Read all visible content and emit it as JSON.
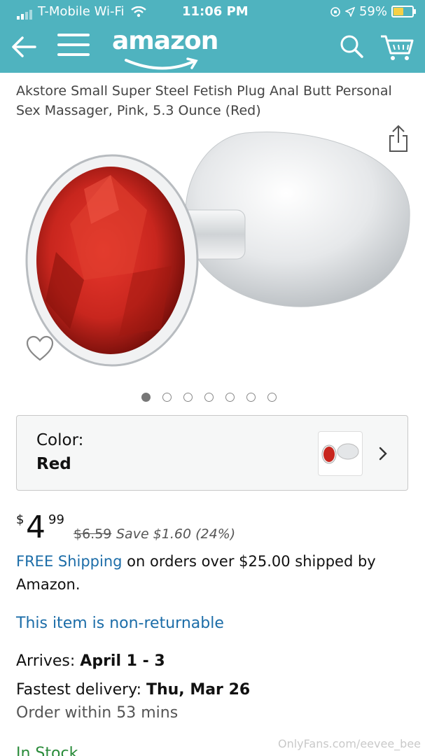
{
  "status": {
    "carrier": "T-Mobile Wi-Fi",
    "time": "11:06 PM",
    "battery": "59%"
  },
  "nav": {
    "logo": "amazon"
  },
  "product": {
    "title": "Akstore Small Super Steel Fetish Plug Anal Butt Personal Sex Massager, Pink, 5.3 Ounce (Red)",
    "image_count": 7,
    "active_image": 1
  },
  "color_selector": {
    "label": "Color:",
    "value": "Red"
  },
  "price": {
    "currency": "$",
    "whole": "4",
    "cents": "99",
    "was": "$6.59",
    "save": "Save $1.60 (24%)"
  },
  "shipping": {
    "link": "FREE Shipping",
    "text": " on orders over $25.00 shipped by Amazon."
  },
  "returns": {
    "text": "This item is non-returnable"
  },
  "delivery": {
    "arrives_label": "Arrives: ",
    "arrives_value": "April 1 - 3",
    "fastest_label": "Fastest delivery: ",
    "fastest_value": "Thu, Mar 26",
    "order_within": "Order within 53 mins"
  },
  "stock": {
    "text": "In Stock."
  },
  "watermark": "OnlyFans.com/eevee_bee",
  "colors": {
    "header": "#4fb3bf",
    "link": "#1c6da8",
    "jewel": "#c8261e"
  }
}
